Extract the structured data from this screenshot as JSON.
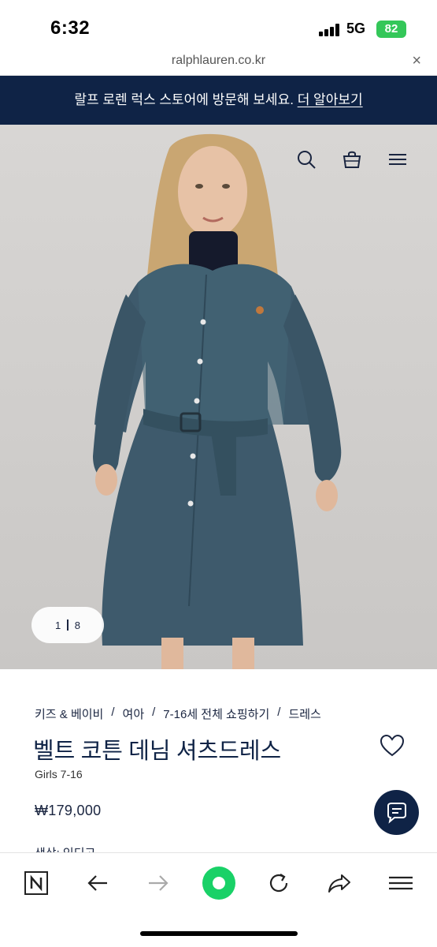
{
  "status": {
    "time": "6:32",
    "network": "5G",
    "battery": "82"
  },
  "browser": {
    "url": "ralphlauren.co.kr",
    "close": "×"
  },
  "promo": {
    "text": "랄프 로렌 럭스 스토어에 방문해 보세요.",
    "link": "더 알아보기"
  },
  "hero": {
    "pager_current": "1",
    "pager_total": "8"
  },
  "breadcrumb": [
    "키즈 & 베이비",
    "여아",
    "7-16세 전체 쇼핑하기",
    "드레스"
  ],
  "product": {
    "title": "벨트 코튼 데님 셔츠드레스",
    "subtitle": "Girls 7-16",
    "price": "₩179,000",
    "next_section": "색상: 인디고"
  },
  "colors": {
    "brand_navy": "#0f2346",
    "reload_green": "#19d167"
  },
  "icons": [
    "search-icon",
    "bag-icon",
    "menu-icon",
    "heart-icon",
    "chat-icon",
    "naver-n-icon",
    "back-arrow-icon",
    "forward-arrow-icon",
    "green-home-icon",
    "reload-icon",
    "share-icon",
    "hamburger-icon"
  ]
}
